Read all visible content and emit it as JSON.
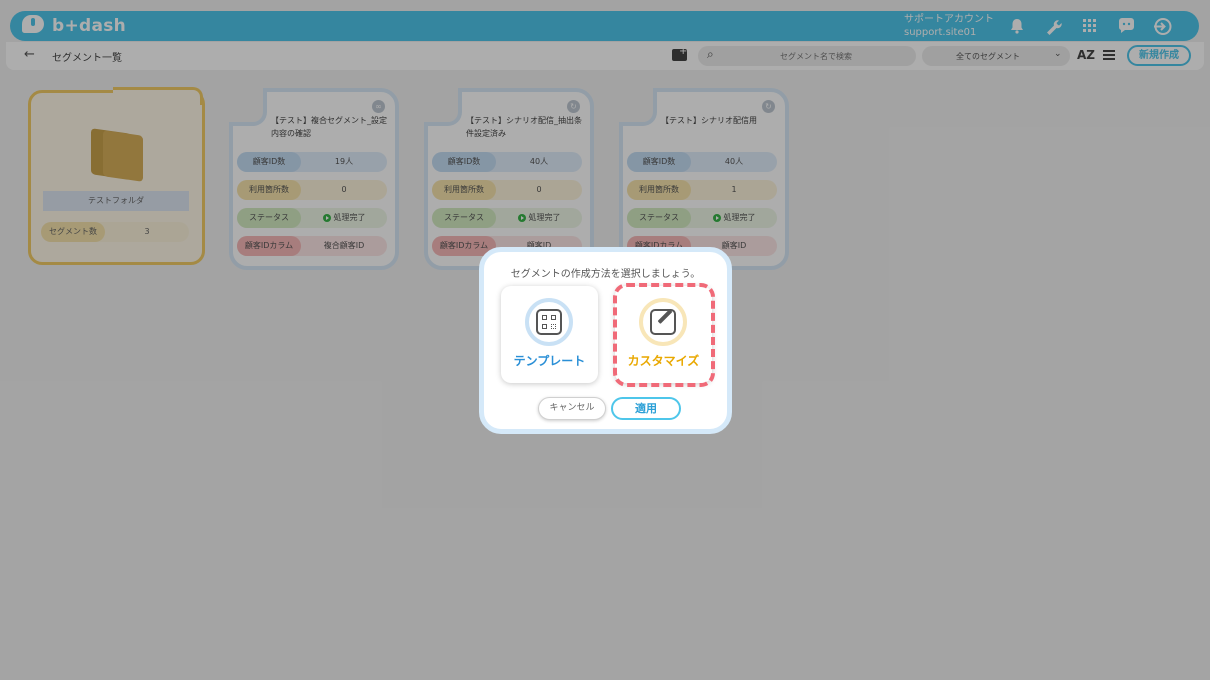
{
  "header": {
    "logo_text": "b+dash",
    "account_line1": "サポートアカウント",
    "account_line2": "support.site01"
  },
  "subbar": {
    "breadcrumb": "セグメント一覧",
    "search_placeholder": "セグメント名で検索",
    "segment_filter": "全てのセグメント",
    "sort_label": "AZ",
    "new_button": "新規作成"
  },
  "folder": {
    "name": "テストフォルダ",
    "count_label": "セグメント数",
    "count_value": "3"
  },
  "cards": [
    {
      "title": "【テスト】複合セグメント_設定内容の確認",
      "rows": [
        {
          "label": "顧客ID数",
          "value": "19人"
        },
        {
          "label": "利用箇所数",
          "value": "0"
        },
        {
          "label": "ステータス",
          "value": "処理完了"
        },
        {
          "label": "顧客IDカラム",
          "value": "複合顧客ID"
        }
      ]
    },
    {
      "title": "【テスト】シナリオ配信_抽出条件設定済み",
      "rows": [
        {
          "label": "顧客ID数",
          "value": "40人"
        },
        {
          "label": "利用箇所数",
          "value": "0"
        },
        {
          "label": "ステータス",
          "value": "処理完了"
        },
        {
          "label": "顧客IDカラム",
          "value": "顧客ID"
        }
      ]
    },
    {
      "title": "【テスト】シナリオ配信用",
      "rows": [
        {
          "label": "顧客ID数",
          "value": "40人"
        },
        {
          "label": "利用箇所数",
          "value": "1"
        },
        {
          "label": "ステータス",
          "value": "処理完了"
        },
        {
          "label": "顧客IDカラム",
          "value": "顧客ID"
        }
      ]
    }
  ],
  "modal": {
    "title": "セグメントの作成方法を選択しましょう。",
    "option_template": "テンプレート",
    "option_custom": "カスタマイズ",
    "cancel": "キャンセル",
    "apply": "適用"
  },
  "icons": {
    "header": [
      "bell-icon",
      "wrench-icon",
      "grid-icon",
      "chat-icon",
      "logout-icon"
    ]
  }
}
